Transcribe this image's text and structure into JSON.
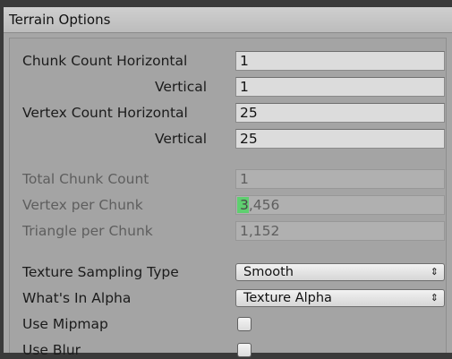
{
  "window": {
    "title": "Terrain Options"
  },
  "chunk_count": {
    "horizontal_label": "Chunk Count Horizontal",
    "horizontal_value": "1",
    "vertical_label": "Vertical",
    "vertical_value": "1"
  },
  "vertex_count": {
    "horizontal_label": "Vertex Count Horizontal",
    "horizontal_value": "25",
    "vertical_label": "Vertical",
    "vertical_value": "25"
  },
  "stats": {
    "total_chunk_label": "Total Chunk Count",
    "total_chunk_value": "1",
    "vertex_per_chunk_label": "Vertex per Chunk",
    "vertex_per_chunk_highlight": "3",
    "vertex_per_chunk_rest": ",456",
    "triangle_per_chunk_label": "Triangle per Chunk",
    "triangle_per_chunk_value": "1,152"
  },
  "options": {
    "texture_sampling_label": "Texture Sampling Type",
    "texture_sampling_value": "Smooth",
    "alpha_label": "What's In Alpha",
    "alpha_value": "Texture Alpha",
    "mipmap_label": "Use Mipmap",
    "mipmap_checked": false,
    "blur_label": "Use Blur",
    "blur_checked": false
  },
  "icons": {
    "dropdown_arrow": "updown-arrow-icon"
  },
  "colors": {
    "highlight": "#5fcf70"
  }
}
